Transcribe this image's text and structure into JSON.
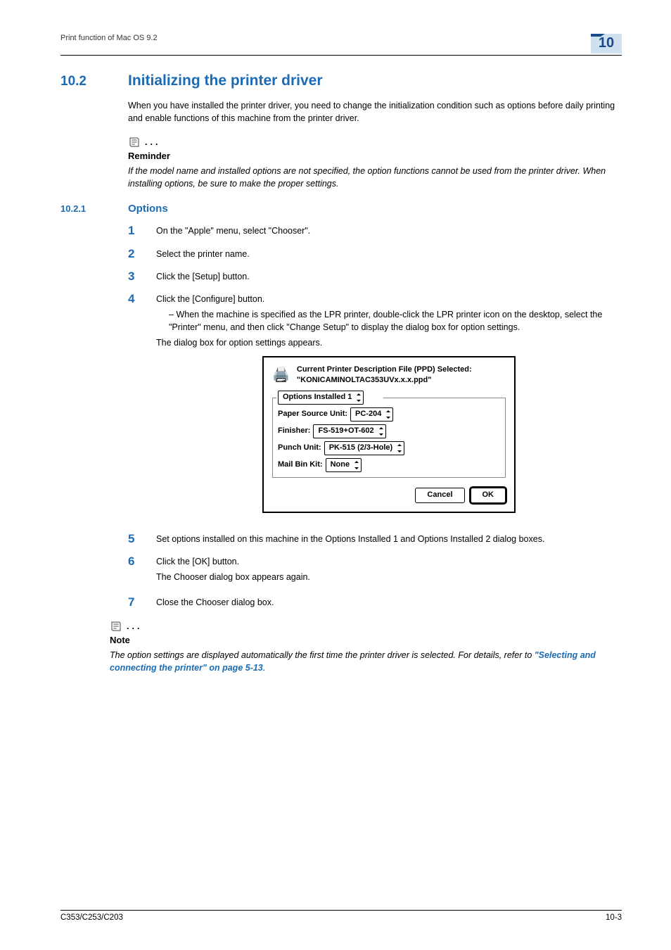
{
  "header": {
    "running_title": "Print function of Mac OS 9.2",
    "chapter_number": "10"
  },
  "section": {
    "number": "10.2",
    "title": "Initializing the printer driver",
    "intro": "When you have installed the printer driver, you need to change the initialization condition such as options before daily printing and enable functions of this machine from the printer driver."
  },
  "reminder": {
    "label": "Reminder",
    "body": "If the model name and installed options are not specified, the option functions cannot be used from the printer driver. When installing options, be sure to make the proper settings."
  },
  "subsection": {
    "number": "10.2.1",
    "title": "Options"
  },
  "steps": {
    "s1": "On the \"Apple\" menu, select \"Chooser\".",
    "s2": "Select the printer name.",
    "s3": "Click the [Setup] button.",
    "s4": "Click the [Configure] button.",
    "s4_bullet": "When the machine is specified as the LPR printer, double-click the LPR printer icon on the desktop, select the \"Printer\" menu, and then click \"Change Setup\" to display the dialog box for option settings.",
    "s4_after": "The dialog box for option settings appears.",
    "s5": "Set options installed on this machine in the Options Installed 1 and Options Installed 2 dialog boxes.",
    "s6": "Click the [OK] button.",
    "s6_after": "The Chooser dialog box appears again.",
    "s7": "Close the Chooser dialog box."
  },
  "dialog": {
    "header_line1": "Current Printer Description File (PPD) Selected:",
    "header_line2": "\"KONICAMINOLTAC353UVx.x.x.ppd\"",
    "group_select": "Options Installed 1",
    "rows": {
      "paper_label": "Paper Source Unit:",
      "paper_value": "PC-204",
      "finisher_label": "Finisher:",
      "finisher_value": "FS-519+OT-602",
      "punch_label": "Punch Unit:",
      "punch_value": "PK-515 (2/3-Hole)",
      "mailbin_label": "Mail Bin Kit:",
      "mailbin_value": "None"
    },
    "cancel": "Cancel",
    "ok": "OK"
  },
  "note": {
    "label": "Note",
    "body_prefix": "The option settings are displayed automatically the first time the printer driver is selected. For details, refer to ",
    "xref": "\"Selecting and connecting the printer\" on page 5-13",
    "body_suffix": "."
  },
  "footer": {
    "model": "C353/C253/C203",
    "page": "10-3"
  }
}
